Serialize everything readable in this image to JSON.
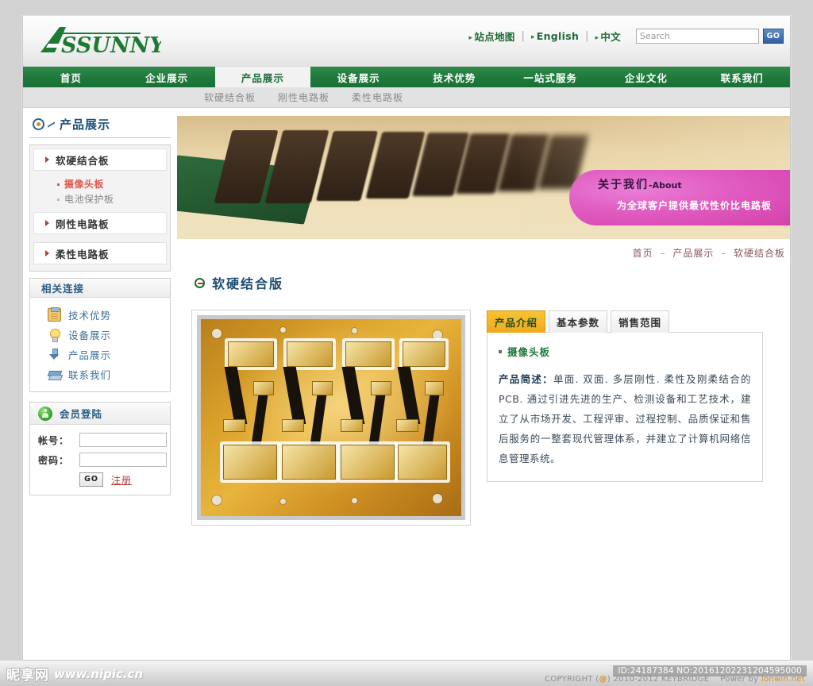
{
  "header": {
    "logo_text": "ASSUNNY",
    "top_links": [
      {
        "label": "站点地图"
      },
      {
        "label": "English"
      },
      {
        "label": "中文"
      }
    ],
    "search_placeholder": "Search",
    "search_value": "",
    "search_button": "GO"
  },
  "mainnav": [
    {
      "label": "首页",
      "active": false
    },
    {
      "label": "企业展示",
      "active": false
    },
    {
      "label": "产品展示",
      "active": true
    },
    {
      "label": "设备展示",
      "active": false
    },
    {
      "label": "技术优势",
      "active": false
    },
    {
      "label": "一站式服务",
      "active": false
    },
    {
      "label": "企业文化",
      "active": false
    },
    {
      "label": "联系我们",
      "active": false
    }
  ],
  "subnav": [
    {
      "label": "软硬结合板"
    },
    {
      "label": "刚性电路板"
    },
    {
      "label": "柔性电路板"
    }
  ],
  "sidebar": {
    "section_title": "产品展示",
    "product_nav": [
      {
        "label": "软硬结合板"
      },
      {
        "label": "刚性电路板"
      },
      {
        "label": "柔性电路板"
      }
    ],
    "product_sub": [
      {
        "label": "摄像头板",
        "current": true
      },
      {
        "label": "电池保护板",
        "current": false
      }
    ],
    "related_title": "相关连接",
    "related_links": [
      {
        "label": "技术优势",
        "icon": "clipboard-icon"
      },
      {
        "label": "设备展示",
        "icon": "lightbulb-icon"
      },
      {
        "label": "产品展示",
        "icon": "download-arrow-icon"
      },
      {
        "label": "联系我们",
        "icon": "books-icon"
      }
    ],
    "login_title": "会员登陆",
    "login_user_label": "帐号：",
    "login_pass_label": "密码：",
    "login_user_value": "",
    "login_pass_value": "",
    "login_button": "GO",
    "register_link": "注册"
  },
  "banner": {
    "badge_title_cn": "关于我们",
    "badge_title_en": "-About",
    "badge_subtitle": "为全球客户提供最优性价比电路板",
    "badge_color": "#e05bc0"
  },
  "breadcrumb": {
    "items": [
      "首页",
      "产品展示",
      "软硬结合板"
    ],
    "separator": "–"
  },
  "page_title": "软硬结合版",
  "product": {
    "image_alt": "柔性印刷电路板 PCB 照片",
    "tabs": [
      {
        "label": "产品介绍",
        "active": true
      },
      {
        "label": "基本参数",
        "active": false
      },
      {
        "label": "销售范围",
        "active": false
      }
    ],
    "content_heading": "摄像头板",
    "content_label": "产品简述：",
    "content_body": "单面. 双面. 多层刚性. 柔性及刚柔结合的PCB. 通过引进先进的生产、检测设备和工艺技术，建立了从市场开发、工程评审、过程控制、品质保证和售后服务的一整套现代管理体系，并建立了计算机网络信息管理系统。"
  },
  "footer": {
    "watermark_cn": "昵享网",
    "watermark_url": "www.nipic.cn",
    "copyright_prefix": "COPYRIGHT (",
    "copyright_at": "@",
    "copyright_suffix": ") 2010-2012 KEYBRIDGE",
    "powerby_label": "Power by",
    "powerby_site": "lonwin.net",
    "id_badge": "ID:24187384 NO:20161202231204595000"
  }
}
